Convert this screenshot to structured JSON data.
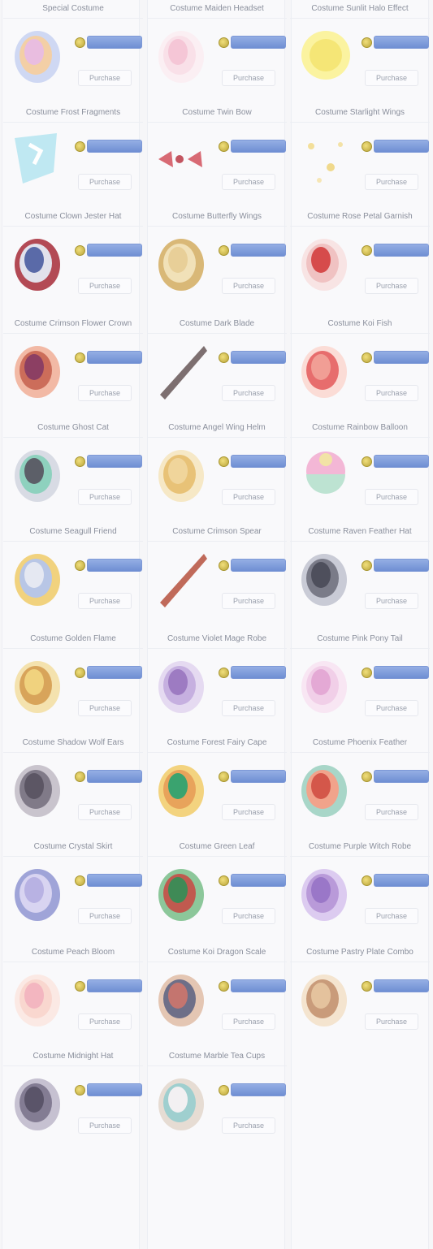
{
  "buy_label": "",
  "details_label": "Purchase",
  "items": [
    {
      "title": "Special Costume",
      "art": "pastel-bouquet"
    },
    {
      "title": "Costume Maiden Headset",
      "art": "pink-ribbon"
    },
    {
      "title": "Costume Sunlit Halo Effect",
      "art": "sun"
    },
    {
      "title": "Costume Frost Fragments",
      "art": "ice-shard"
    },
    {
      "title": "Costume Twin Bow",
      "art": "red-bows"
    },
    {
      "title": "Costume Starlight Wings",
      "art": "sparkles"
    },
    {
      "title": "Costume Clown Jester Hat",
      "art": "jester"
    },
    {
      "title": "Costume Butterfly Wings",
      "art": "moth-wings"
    },
    {
      "title": "Costume Rose Petal Garnish",
      "art": "red-petal"
    },
    {
      "title": "Costume Crimson Flower Crown",
      "art": "flower-wreath"
    },
    {
      "title": "Costume Dark Blade",
      "art": "blade"
    },
    {
      "title": "Costume Koi Fish",
      "art": "koi"
    },
    {
      "title": "Costume Ghost Cat",
      "art": "ghost-cat"
    },
    {
      "title": "Costume Angel Wing Helm",
      "art": "gold-helm"
    },
    {
      "title": "Costume Rainbow Balloon",
      "art": "balloon"
    },
    {
      "title": "Costume Seagull Friend",
      "art": "seagull"
    },
    {
      "title": "Costume Crimson Spear",
      "art": "spear"
    },
    {
      "title": "Costume Raven Feather Hat",
      "art": "raven"
    },
    {
      "title": "Costume Golden Flame",
      "art": "gold-flame"
    },
    {
      "title": "Costume Violet Mage Robe",
      "art": "violet-robe"
    },
    {
      "title": "Costume Pink Pony Tail",
      "art": "pink-hair"
    },
    {
      "title": "Costume Shadow Wolf Ears",
      "art": "wolf"
    },
    {
      "title": "Costume Forest Fairy Cape",
      "art": "fairy"
    },
    {
      "title": "Costume Phoenix Feather",
      "art": "phoenix"
    },
    {
      "title": "Costume Crystal Skirt",
      "art": "crystal-skirt"
    },
    {
      "title": "Costume Green Leaf",
      "art": "leaf-cape"
    },
    {
      "title": "Costume Purple Witch Robe",
      "art": "witch-robe"
    },
    {
      "title": "Costume Peach Bloom",
      "art": "peach"
    },
    {
      "title": "Costume Koi Dragon Scale",
      "art": "dragon"
    },
    {
      "title": "Costume Pastry Plate Combo",
      "art": "pastry"
    },
    {
      "title": "Costume Midnight Hat",
      "art": "dark-hat"
    },
    {
      "title": "Costume Marble Tea Cups",
      "art": "teacups"
    }
  ]
}
